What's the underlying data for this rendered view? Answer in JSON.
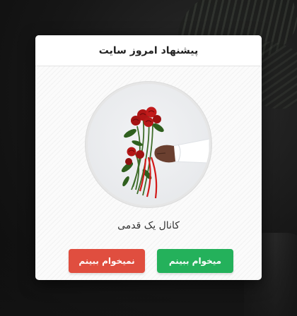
{
  "modal": {
    "title": "پیشنهاد امروز سایت",
    "caption": "کانال یک قدمی",
    "accept_label": "میخوام ببینم",
    "decline_label": "نمیخوام ببینم"
  },
  "icons": {
    "product_image": "bouquet-of-red-roses-in-hand"
  },
  "colors": {
    "accept": "#24b15b",
    "decline": "#e04e3f",
    "modal_background": "#fbfbfb",
    "page_backdrop": "#161616"
  }
}
